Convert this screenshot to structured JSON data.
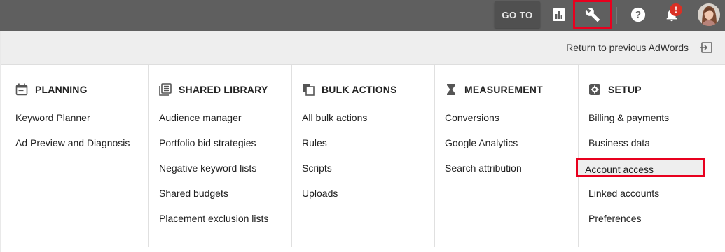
{
  "topbar": {
    "goto_label": "GO TO",
    "icons": [
      "reports-icon",
      "wrench-icon",
      "help-icon",
      "bell-icon"
    ],
    "notification_badge": "!"
  },
  "return_bar": {
    "label": "Return to previous AdWords"
  },
  "columns": [
    {
      "title": "PLANNING",
      "icon": "calendar-icon",
      "items": [
        "Keyword Planner",
        "Ad Preview and Diagnosis"
      ]
    },
    {
      "title": "SHARED LIBRARY",
      "icon": "library-icon",
      "items": [
        "Audience manager",
        "Portfolio bid strategies",
        "Negative keyword lists",
        "Shared budgets",
        "Placement exclusion lists"
      ]
    },
    {
      "title": "BULK ACTIONS",
      "icon": "copy-icon",
      "items": [
        "All bulk actions",
        "Rules",
        "Scripts",
        "Uploads"
      ]
    },
    {
      "title": "MEASUREMENT",
      "icon": "hourglass-icon",
      "items": [
        "Conversions",
        "Google Analytics",
        "Search attribution"
      ]
    },
    {
      "title": "SETUP",
      "icon": "settings-icon",
      "items": [
        "Billing & payments",
        "Business data",
        "Account access",
        "Linked accounts",
        "Preferences"
      ],
      "highlighted_item": "Account access"
    }
  ],
  "colors": {
    "topbar": "#5f5f5f",
    "highlight_border": "#e8001e",
    "badge": "#d93025"
  }
}
